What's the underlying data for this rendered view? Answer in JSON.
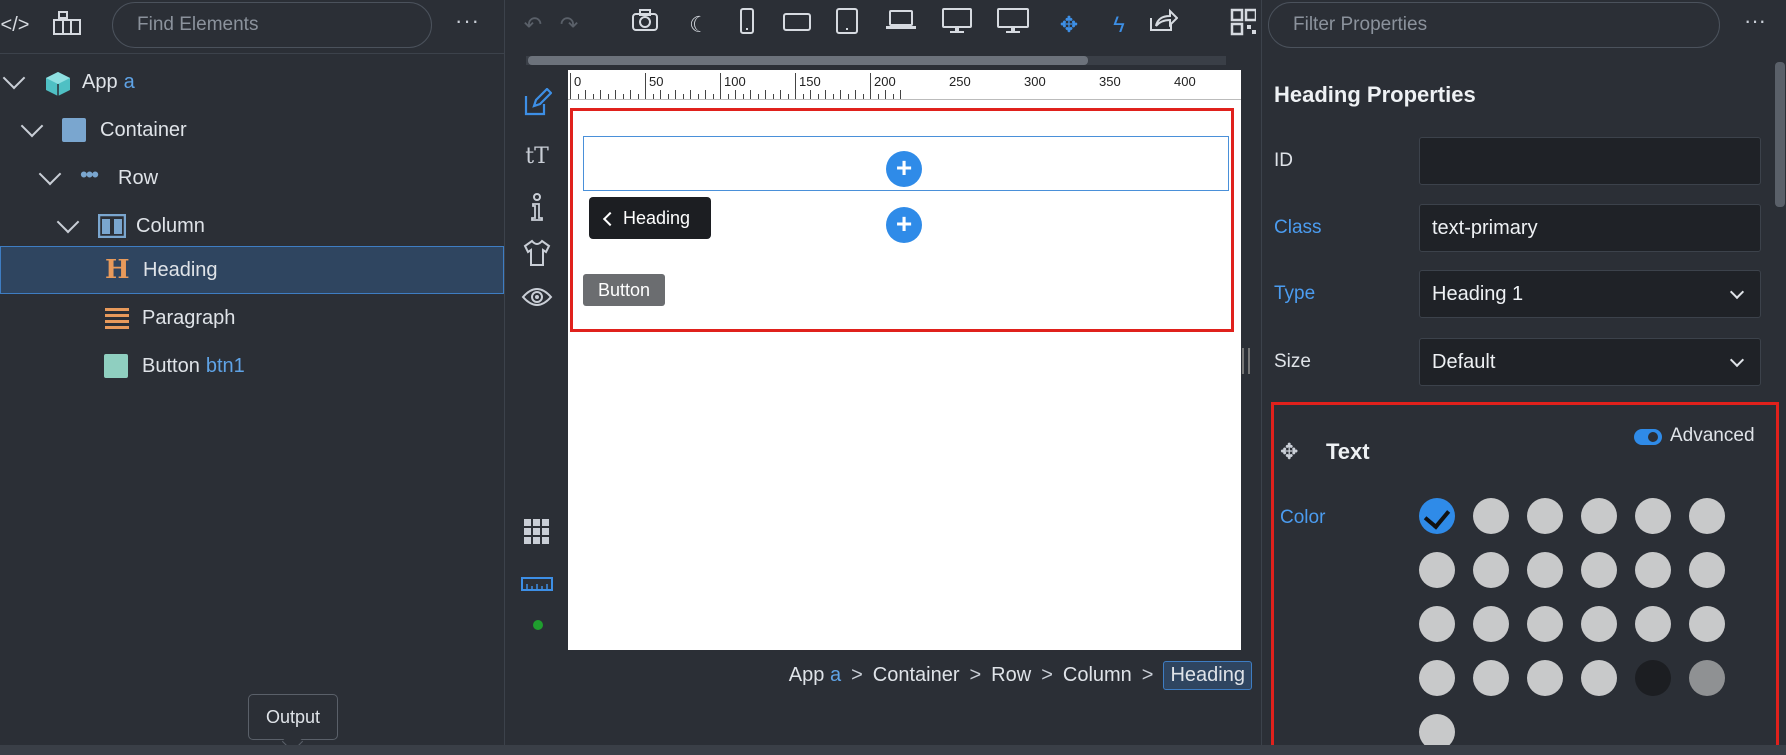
{
  "left_panel": {
    "search_placeholder": "Find Elements",
    "more_label": "···",
    "tree": [
      {
        "label": "App",
        "tag": "a"
      },
      {
        "label": "Container",
        "tag": ""
      },
      {
        "label": "Row",
        "tag": ""
      },
      {
        "label": "Column",
        "tag": ""
      },
      {
        "label": "Heading",
        "tag": ""
      },
      {
        "label": "Paragraph",
        "tag": ""
      },
      {
        "label": "Button",
        "tag": "btn1"
      }
    ]
  },
  "canvas": {
    "ruler_labels": [
      "0",
      "50",
      "100",
      "150",
      "200",
      "250",
      "300",
      "350",
      "400"
    ],
    "heading_chip": "Heading",
    "button_label": "Button",
    "plus": "+"
  },
  "breadcrumb": {
    "items": [
      "App",
      "Container",
      "Row",
      "Column"
    ],
    "app_tag": "a",
    "active": "Heading",
    "sep": ">"
  },
  "output_tooltip": "Output",
  "right_panel": {
    "filter_placeholder": "Filter Properties",
    "title": "Heading Properties",
    "props": {
      "id_label": "ID",
      "id_value": "",
      "class_label": "Class",
      "class_value": "text-primary",
      "type_label": "Type",
      "type_value": "Heading 1",
      "size_label": "Size",
      "size_value": "Default"
    },
    "text_section": {
      "title": "Text",
      "advanced_label": "Advanced",
      "color_label": "Color"
    }
  },
  "colors": {
    "accent": "#2f8be8",
    "selection_outline": "#e0211c",
    "swatch_default": "#c8c9ca",
    "swatch_dark": "#1c1e22",
    "swatch_gray": "#8f9193"
  }
}
